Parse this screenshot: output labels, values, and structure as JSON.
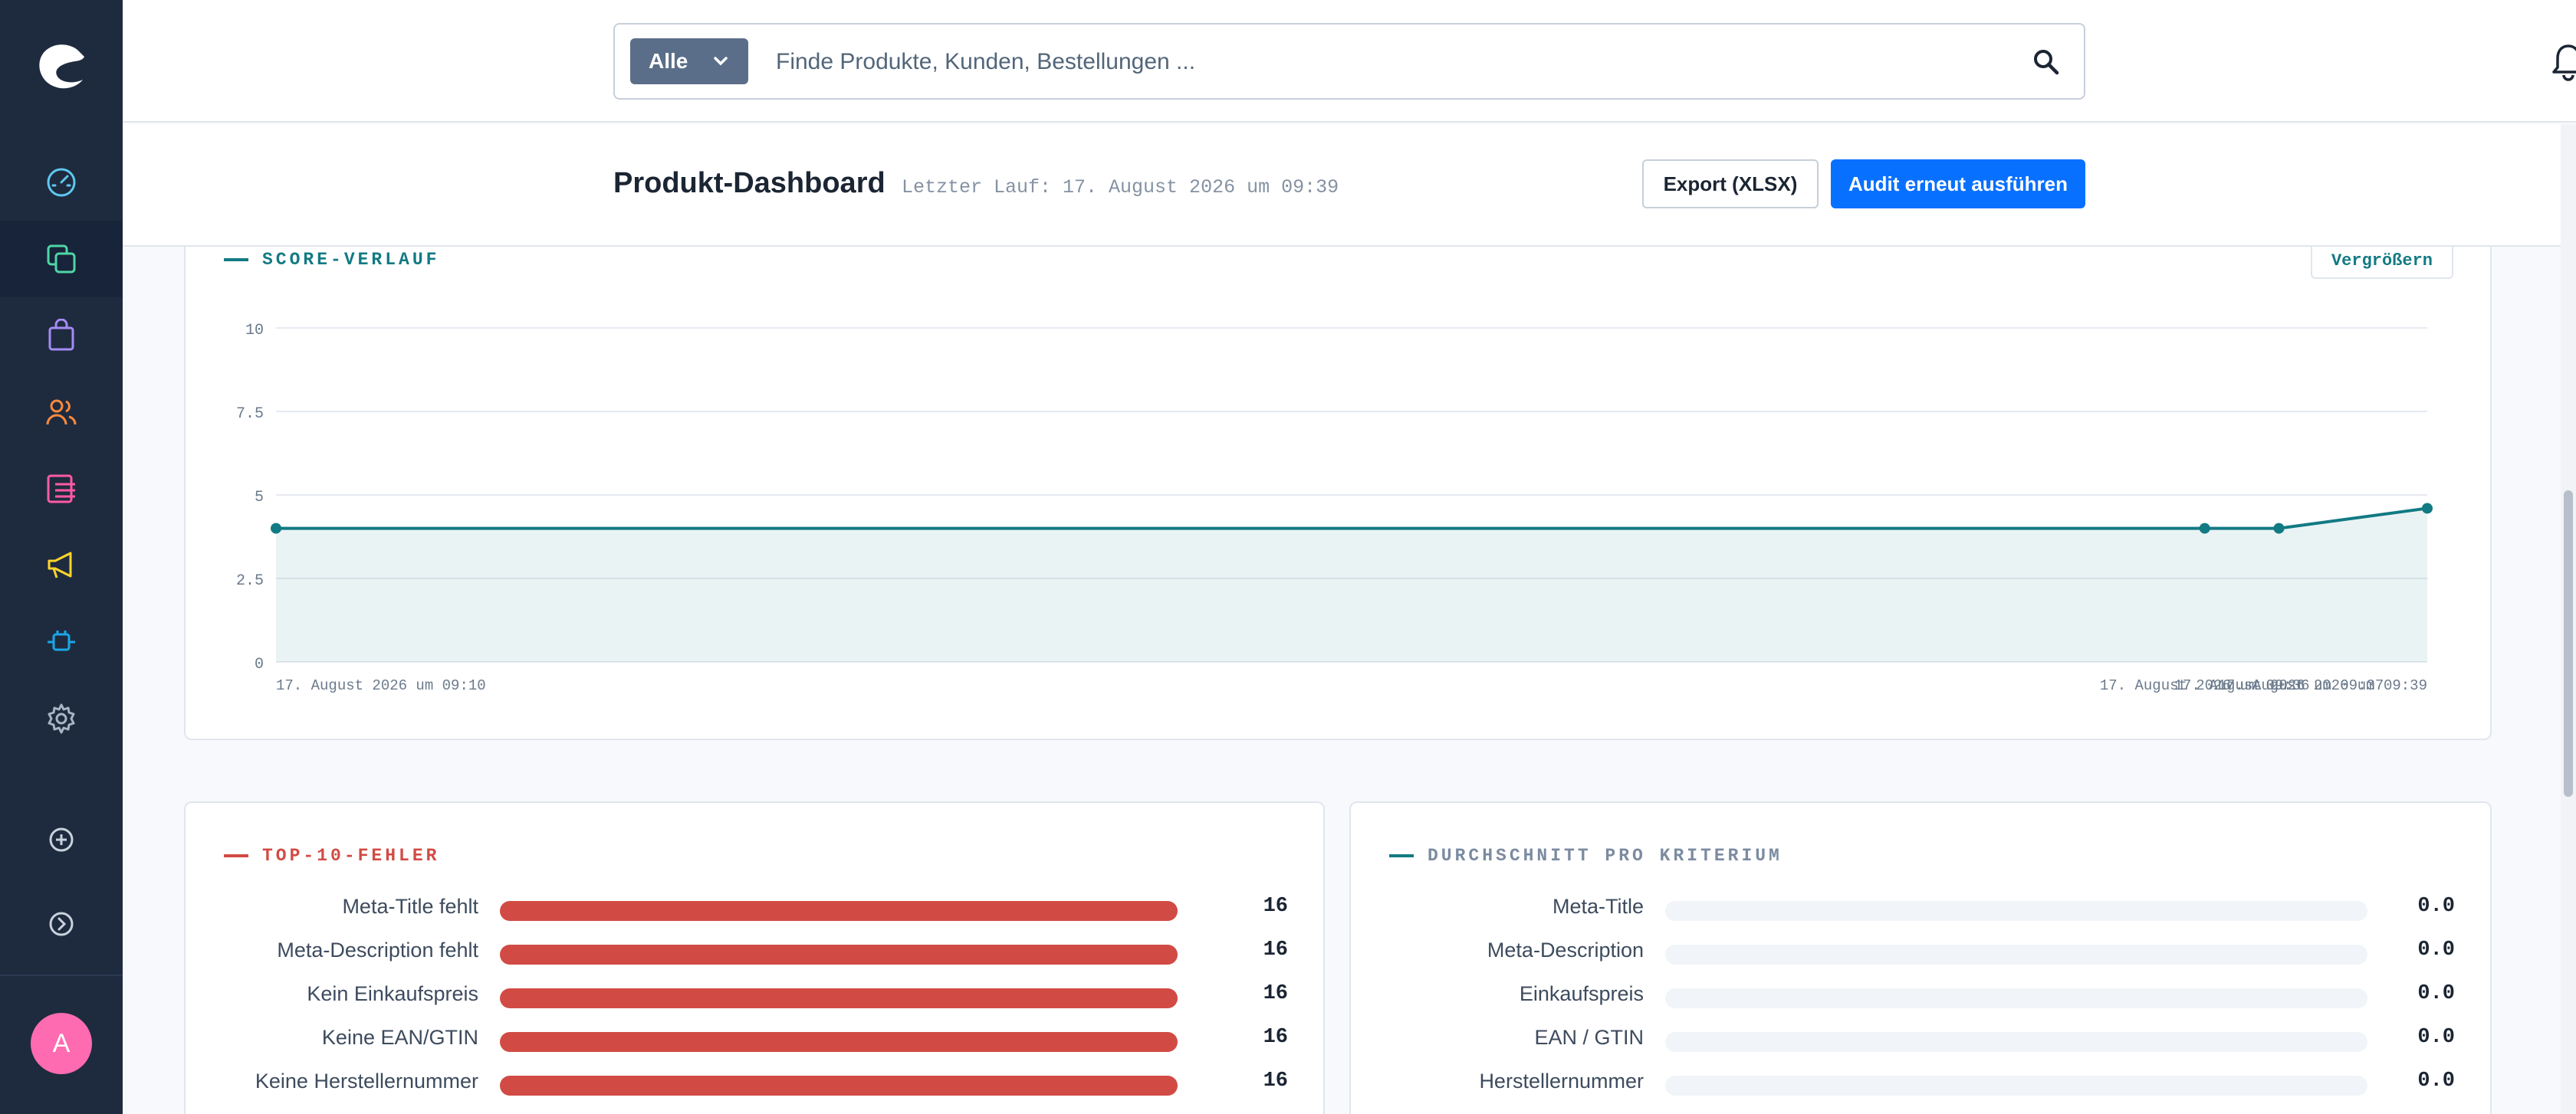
{
  "colors": {
    "sidebar_bg": "#1e2b3f",
    "accent_teal": "#127a83",
    "error_red": "#d14b44",
    "avg_slate": "#7b8ba0",
    "primary_blue": "#0870ff"
  },
  "sidebar": {
    "logo_icon": "shopware-logo-icon",
    "items": [
      {
        "icon": "dashboard-gauge-icon",
        "color": "#5ec8f0"
      },
      {
        "icon": "products-stack-icon",
        "color": "#4fd6a5"
      },
      {
        "icon": "orders-bag-icon",
        "color": "#a58cf5"
      },
      {
        "icon": "customers-users-icon",
        "color": "#ff8a3d"
      },
      {
        "icon": "content-list-icon",
        "color": "#ff5aa5"
      },
      {
        "icon": "marketing-megaphone-icon",
        "color": "#ffd42a"
      },
      {
        "icon": "extensions-plug-icon",
        "color": "#1aa7e8"
      },
      {
        "icon": "settings-gear-icon",
        "color": "#a9b4c4"
      },
      {
        "icon": "add-circle-icon",
        "color": "#c9d1dc"
      },
      {
        "icon": "expand-circle-icon",
        "color": "#c9d1dc"
      }
    ],
    "avatar_initial": "A"
  },
  "topbar": {
    "search_type": "Alle",
    "search_placeholder": "Finde Produkte, Kunden, Bestellungen ..."
  },
  "page": {
    "title": "Produkt-Dashboard",
    "last_run": "Letzter Lauf: 17. August 2026 um 09:39",
    "export_button": "Export (XLSX)",
    "audit_button": "Audit erneut ausführen"
  },
  "score_card": {
    "title": "SCORE-VERLAUF",
    "enlarge_button": "Vergrößern"
  },
  "chart_data": {
    "type": "area",
    "title": "",
    "x": [
      "17. August 2026 um 09:10",
      "17. August 2026 um 09:36",
      "17. August 2026 um 09:37",
      "17. August 2026 um 09:39"
    ],
    "x_positions_minutes": [
      0,
      26,
      27,
      29
    ],
    "series": [
      {
        "values": [
          4.0,
          4.0,
          4.0,
          4.6
        ]
      }
    ],
    "ylim": [
      0,
      10
    ],
    "yticks": [
      "0",
      "2.5",
      "5",
      "7.5",
      "10"
    ],
    "ytick_values": [
      0,
      2.5,
      5,
      7.5,
      10
    ],
    "grid": true,
    "line_color": "#127a83"
  },
  "errors_card": {
    "title": "TOP-10-FEHLER",
    "max": 16,
    "rows": [
      {
        "label": "Meta-Title fehlt",
        "value": "16",
        "num": 16
      },
      {
        "label": "Meta-Description fehlt",
        "value": "16",
        "num": 16
      },
      {
        "label": "Kein Einkaufspreis",
        "value": "16",
        "num": 16
      },
      {
        "label": "Keine EAN/GTIN",
        "value": "16",
        "num": 16
      },
      {
        "label": "Keine Herstellernummer",
        "value": "16",
        "num": 16
      }
    ]
  },
  "avg_card": {
    "title": "DURCHSCHNITT PRO KRITERIUM",
    "max": 10,
    "rows": [
      {
        "label": "Meta-Title",
        "value": "0.0",
        "num": 0
      },
      {
        "label": "Meta-Description",
        "value": "0.0",
        "num": 0
      },
      {
        "label": "Einkaufspreis",
        "value": "0.0",
        "num": 0
      },
      {
        "label": "EAN / GTIN",
        "value": "0.0",
        "num": 0
      },
      {
        "label": "Herstellernummer",
        "value": "0.0",
        "num": 0
      }
    ]
  }
}
